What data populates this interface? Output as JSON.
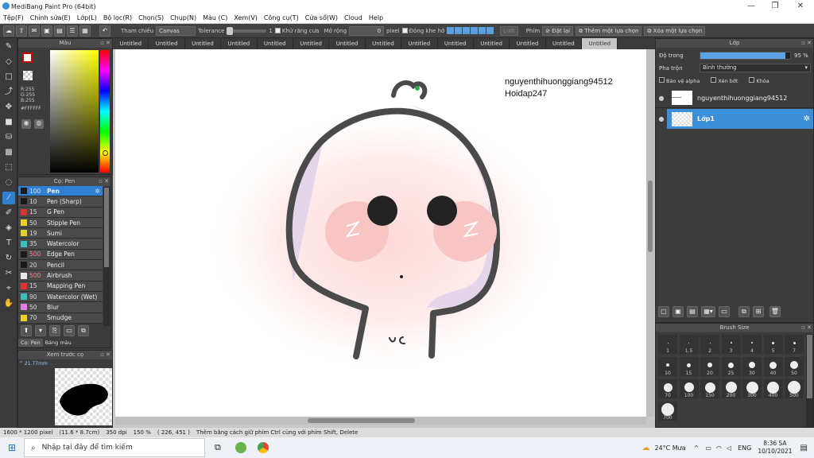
{
  "window": {
    "title": "MediBang Paint Pro (64bit)",
    "minimize": "—",
    "maximize": "❐",
    "close": "✕"
  },
  "menu": [
    "Tệp(F)",
    "Chỉnh sửa(E)",
    "Lớp(L)",
    "Bộ lọc(R)",
    "Chọn(S)",
    "Chụp(N)",
    "Màu (C)",
    "Xem(V)",
    "Công cụ(T)",
    "Cửa sổ(W)",
    "Cloud",
    "Help"
  ],
  "toolbar": {
    "tham_chieu": "Tham chiếu",
    "canvas_select": "Canvas",
    "tolerance": "Tolerance",
    "tolerance_val": "1",
    "khu_rang_cua": "Khử răng cưa",
    "mo_rong": "Mở rộng",
    "mo_rong_val": "0",
    "pixel": "pixel",
    "dong_khe_ho": "Đóng khe hở",
    "grid_btn": "Lưới",
    "phim": "Phím",
    "dat_lai": "Đặt lại",
    "them_lua_chon": "Thêm một lựa chọn",
    "xoa_lua_chon": "Xóa một lựa chọn"
  },
  "tabs": [
    "Untitled",
    "Untitled",
    "Untitled",
    "Untitled",
    "Untitled",
    "Untitled",
    "Untitled",
    "Untitled",
    "Untitled",
    "Untitled",
    "Untitled",
    "Untitled",
    "Untitled",
    "Untitled"
  ],
  "color_panel": {
    "title": "Màu",
    "r": "R:255",
    "g": "G:255",
    "b": "B:255",
    "hex": "#FFFFFF"
  },
  "brush_panel": {
    "title": "Cọ: Pen",
    "items": [
      {
        "size": "100",
        "name": "Pen",
        "color": "#1a1a1a"
      },
      {
        "size": "10",
        "name": "Pen (Sharp)",
        "color": "#1a1a1a"
      },
      {
        "size": "15",
        "name": "G Pen",
        "color": "#e03030"
      },
      {
        "size": "50",
        "name": "Stipple Pen",
        "color": "#e6d020"
      },
      {
        "size": "19",
        "name": "Sumi",
        "color": "#e6d020"
      },
      {
        "size": "35",
        "name": "Watercolor",
        "color": "#39c0c0"
      },
      {
        "size": "500",
        "name": "Edge Pen",
        "color": "#1a1a1a"
      },
      {
        "size": "20",
        "name": "Pencil",
        "color": "#1a1a1a"
      },
      {
        "size": "500",
        "name": "Airbrush",
        "color": "#e8e8e8"
      },
      {
        "size": "15",
        "name": "Mapping Pen",
        "color": "#e03030"
      },
      {
        "size": "90",
        "name": "Watercolor (Wet)",
        "color": "#39c0c0"
      },
      {
        "size": "50",
        "name": "Blur",
        "color": "#e080e0"
      },
      {
        "size": "70",
        "name": "Smudge",
        "color": "#e6d020"
      }
    ],
    "tab1": "Cọ: Pen",
    "tab2": "Bảng màu"
  },
  "preview_panel": {
    "title": "Xem trước cọ",
    "size": "^ 21.77mm"
  },
  "canvas_text": {
    "line1": "nguyenthihuonggiang94512",
    "line2": "Hoidap247"
  },
  "layer_panel": {
    "title": "Lớp",
    "opacity_label": "Độ trong",
    "opacity_value": "95 %",
    "opacity_fraction": 0.95,
    "blend_label": "Pha trộn",
    "blend_value": "Bình thường",
    "protect_alpha": "Bảo vệ alpha",
    "clipping": "Xén bớt",
    "lock": "Khóa",
    "layers": [
      {
        "name": "nguyenthihuonggiang94512",
        "selected": false
      },
      {
        "name": "Lớp1",
        "selected": true
      }
    ]
  },
  "brush_size": {
    "title": "Brush Size",
    "sizes": [
      "1",
      "1.5",
      "2",
      "3",
      "4",
      "5",
      "7",
      "10",
      "15",
      "20",
      "25",
      "30",
      "40",
      "50",
      "70",
      "100",
      "150",
      "200",
      "300",
      "400",
      "500",
      "700"
    ]
  },
  "status": {
    "dims": "1600 * 1200 pixel",
    "cm": "(11.6 * 8.7cm)",
    "dpi": "350 dpi",
    "zoom": "150 %",
    "coords": "( 226, 451 )",
    "hint": "Thêm bằng cách giữ phím Ctrl cùng với phím Shift, Delete"
  },
  "taskbar": {
    "search": "Nhập tại đây để tìm kiếm",
    "weather": "24°C  Mưa",
    "lang": "ENG",
    "time": "8:36 SA",
    "date": "10/10/2021"
  }
}
